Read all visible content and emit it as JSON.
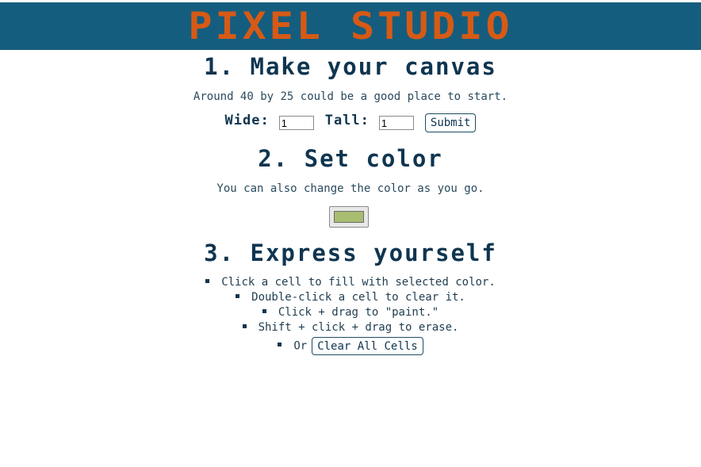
{
  "app": {
    "title": "PIXEL STUDIO"
  },
  "colors": {
    "banner_bg": "#155d7e",
    "title": "#d65a15",
    "heading": "#0f3550",
    "selected_color": "#a8bd70"
  },
  "step1": {
    "heading": "1. Make your canvas",
    "hint": "Around 40 by 25 could be a good place to start.",
    "wide_label": "Wide:",
    "wide_value": "1",
    "tall_label": "Tall:",
    "tall_value": "1",
    "submit_label": "Submit"
  },
  "step2": {
    "heading": "2. Set color",
    "hint": "You can also change the color as you go.",
    "color_value": "#a8bd70"
  },
  "step3": {
    "heading": "3. Express yourself",
    "items": [
      "Click a cell to fill with selected color.",
      "Double-click a cell to clear it.",
      "Click + drag to \"paint.\"",
      "Shift + click + drag to erase."
    ],
    "or_label": "Or",
    "clear_label": "Clear All Cells"
  }
}
